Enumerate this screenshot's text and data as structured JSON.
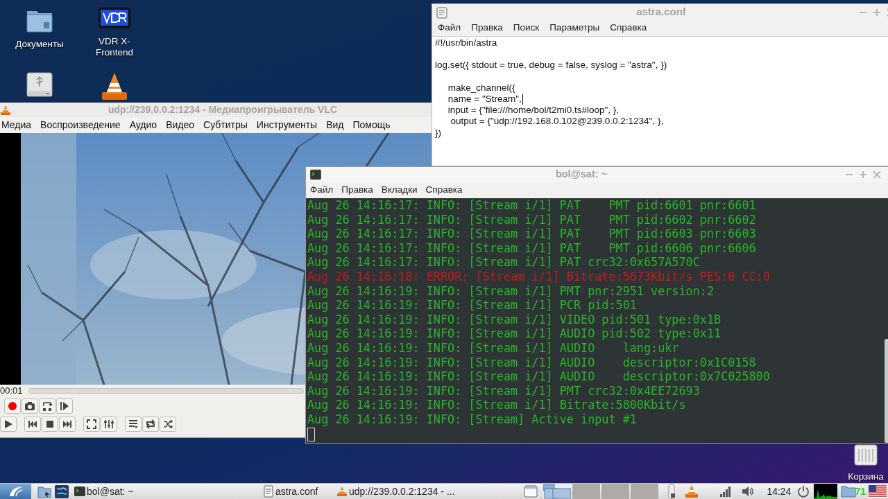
{
  "desktop": {
    "icons": [
      {
        "kind": "folder",
        "label": "Документы"
      },
      {
        "kind": "vdr",
        "label": "VDR X-Frontend"
      },
      {
        "kind": "drive"
      },
      {
        "kind": "vlc"
      },
      {
        "kind": "trash",
        "label": "Корзина"
      }
    ]
  },
  "vlc": {
    "title": "udp://239.0.0.2:1234 - Медиапроигрыватель VLC",
    "menu": [
      "Медиа",
      "Воспроизведение",
      "Аудио",
      "Видео",
      "Субтитры",
      "Инструменты",
      "Вид",
      "Помощь"
    ],
    "time": "00:01"
  },
  "editor": {
    "title": "astra.conf",
    "menu": [
      "Файл",
      "Правка",
      "Поиск",
      "Параметры",
      "Справка"
    ],
    "blocks": [
      {
        "lines": [
          {
            "text": "#!/usr/bin/astra",
            "caret": false
          }
        ]
      },
      {
        "lines": [
          {
            "text": "log.set({ stdout = true, debug = false, syslog = \"astra\", })",
            "caret": false
          }
        ]
      },
      {
        "lines": [
          {
            "text": "     make_channel({",
            "caret": false
          },
          {
            "text": "     name = \"Stream\",",
            "caret": true
          },
          {
            "text": "     input = {\"file:///home/bol/t2mi0.ts#loop\", },",
            "caret": false
          },
          {
            "text": "      output = {\"udp://192.168.0.102@239.0.0.2:1234\", },",
            "caret": false
          },
          {
            "text": "})",
            "caret": false
          }
        ]
      }
    ]
  },
  "terminal": {
    "title": "bol@sat: ~",
    "menu": [
      "Файл",
      "Правка",
      "Вкладки",
      "Справка"
    ],
    "lines": [
      {
        "kind": "info",
        "text": "Aug 26 14:16:17: INFO: [Stream i/1] PAT    PMT pid:6601 pnr:6601"
      },
      {
        "kind": "info",
        "text": "Aug 26 14:16:17: INFO: [Stream i/1] PAT    PMT pid:6602 pnr:6602"
      },
      {
        "kind": "info",
        "text": "Aug 26 14:16:17: INFO: [Stream i/1] PAT    PMT pid:6603 pnr:6603"
      },
      {
        "kind": "info",
        "text": "Aug 26 14:16:17: INFO: [Stream i/1] PAT    PMT pid:6606 pnr:6606"
      },
      {
        "kind": "info",
        "text": "Aug 26 14:16:17: INFO: [Stream i/1] PAT crc32:0x657A570C"
      },
      {
        "kind": "error",
        "text": "Aug 26 14:16:18: ERROR: [Stream i/1] Bitrate:5673Kbit/s PES:0 CC:0"
      },
      {
        "kind": "info",
        "text": "Aug 26 14:16:19: INFO: [Stream i/1] PMT pnr:2951 version:2"
      },
      {
        "kind": "info",
        "text": "Aug 26 14:16:19: INFO: [Stream i/1] PCR pid:501"
      },
      {
        "kind": "info",
        "text": "Aug 26 14:16:19: INFO: [Stream i/1] VIDEO pid:501 type:0x1B"
      },
      {
        "kind": "info",
        "text": "Aug 26 14:16:19: INFO: [Stream i/1] AUDIO pid:502 type:0x11"
      },
      {
        "kind": "info",
        "text": "Aug 26 14:16:19: INFO: [Stream i/1] AUDIO    lang:ukr"
      },
      {
        "kind": "info",
        "text": "Aug 26 14:16:19: INFO: [Stream i/1] AUDIO    descriptor:0x1C0158"
      },
      {
        "kind": "info",
        "text": "Aug 26 14:16:19: INFO: [Stream i/1] AUDIO    descriptor:0x7C025800"
      },
      {
        "kind": "info",
        "text": "Aug 26 14:16:19: INFO: [Stream i/1] PMT crc32:0x4EE72693"
      },
      {
        "kind": "info",
        "text": "Aug 26 14:16:19: INFO: [Stream i/1] Bitrate:5800Kbit/s"
      },
      {
        "kind": "info",
        "text": "Aug 26 14:16:19: INFO: [Stream] Active input #1"
      }
    ]
  },
  "taskbar": {
    "tasks": [
      {
        "kind": "terminal",
        "label": "bol@sat: ~"
      },
      {
        "kind": "editor",
        "label": "astra.conf"
      },
      {
        "kind": "vlc",
        "label": "udp://239.0.0.2:1234 - ..."
      }
    ],
    "workspaces": [
      {
        "selected": true
      },
      {
        "selected": false
      },
      {
        "selected": false
      },
      {
        "selected": false
      }
    ],
    "clock": "14:24",
    "tray_badge": "71"
  }
}
